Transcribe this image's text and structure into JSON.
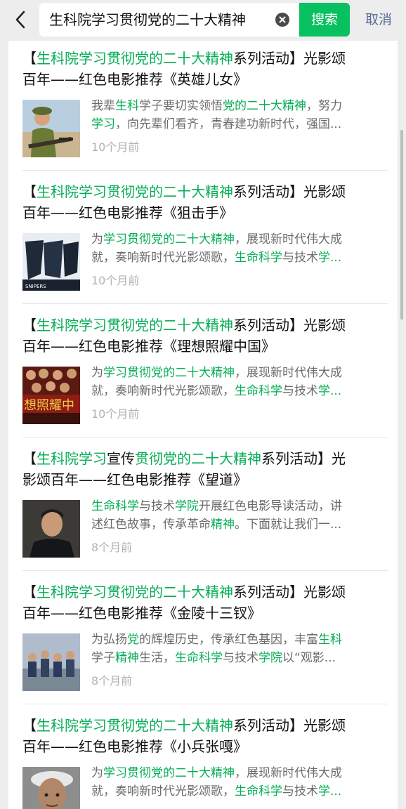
{
  "search": {
    "query": "生科院学习贯彻党的二十大精神",
    "button_label": "搜索",
    "cancel_label": "取消"
  },
  "colors": {
    "highlight": "#06ad56",
    "accent": "#07c160",
    "link": "#576b95"
  },
  "results": [
    {
      "title_segments": [
        {
          "t": "【",
          "h": false
        },
        {
          "t": "生科院学习贯彻党的二十大精神",
          "h": true
        },
        {
          "t": "系列活动】光影颂",
          "h": false
        },
        {
          "t": "百年——红色电影推荐《英雄儿女》",
          "h": false
        }
      ],
      "summary_segments": [
        {
          "t": "我辈",
          "h": false
        },
        {
          "t": "生科",
          "h": true
        },
        {
          "t": "学子要切实领悟",
          "h": false
        },
        {
          "t": "党的二十大精神",
          "h": true
        },
        {
          "t": "，努力",
          "h": false
        },
        {
          "t": "学习",
          "h": true
        },
        {
          "t": "，向先辈们看齐，青春建功新时代，强国...",
          "h": false
        }
      ],
      "time": "10个月前",
      "thumb": "soldier-thumbnail"
    },
    {
      "title_segments": [
        {
          "t": "【",
          "h": false
        },
        {
          "t": "生科院学习贯彻党的二十大精神",
          "h": true
        },
        {
          "t": "系列活动】光影颂",
          "h": false
        },
        {
          "t": "百年——红色电影推荐《狙击手》",
          "h": false
        }
      ],
      "summary_segments": [
        {
          "t": "为",
          "h": false
        },
        {
          "t": "学习贯彻党的二十大精神",
          "h": true
        },
        {
          "t": "，展现新时代伟大成",
          "h": false
        },
        {
          "t": "就，奏响新时代光影颂歌，",
          "h": false
        },
        {
          "t": "生命科学",
          "h": true
        },
        {
          "t": "与技术",
          "h": false
        },
        {
          "t": "学...",
          "h": true
        }
      ],
      "time": "10个月前",
      "thumb": "snipers-poster-thumbnail",
      "thumb_text": "SNIPERS"
    },
    {
      "title_segments": [
        {
          "t": "【",
          "h": false
        },
        {
          "t": "生科院学习贯彻党的二十大精神",
          "h": true
        },
        {
          "t": "系列活动】光影颂",
          "h": false
        },
        {
          "t": "百年——红色电影推荐《理想照耀中国》",
          "h": false
        }
      ],
      "summary_segments": [
        {
          "t": "为",
          "h": false
        },
        {
          "t": "学习贯彻党的二十大精神",
          "h": true
        },
        {
          "t": "，展现新时代伟大成",
          "h": false
        },
        {
          "t": "就，奏响新时代光影颂歌，",
          "h": false
        },
        {
          "t": "生命科学",
          "h": true
        },
        {
          "t": "与技术",
          "h": false
        },
        {
          "t": "学...",
          "h": true
        }
      ],
      "time": "10个月前",
      "thumb": "ideal-poster-thumbnail",
      "thumb_text": "想照耀中"
    },
    {
      "title_segments": [
        {
          "t": "【",
          "h": false
        },
        {
          "t": "生科院学习",
          "h": true
        },
        {
          "t": "宣传",
          "h": false
        },
        {
          "t": "贯彻党的二十大精神",
          "h": true
        },
        {
          "t": "系列活动】光",
          "h": false
        },
        {
          "t": "影颂百年——红色电影推荐《望道》",
          "h": false
        }
      ],
      "summary_segments": [
        {
          "t": "生命科学",
          "h": true
        },
        {
          "t": "与技术",
          "h": false
        },
        {
          "t": "学院",
          "h": true
        },
        {
          "t": "开展红色电影导读活动，讲",
          "h": false
        },
        {
          "t": "述红色故事，传承革命",
          "h": false
        },
        {
          "t": "精神",
          "h": true
        },
        {
          "t": "。下面就让我们一...",
          "h": false
        }
      ],
      "time": "8个月前",
      "thumb": "portrait-thumbnail"
    },
    {
      "title_segments": [
        {
          "t": "【",
          "h": false
        },
        {
          "t": "生科院学习贯彻党的二十大精神",
          "h": true
        },
        {
          "t": "系列活动】光影颂",
          "h": false
        },
        {
          "t": "百年——红色电影推荐《金陵十三钗》",
          "h": false
        }
      ],
      "summary_segments": [
        {
          "t": "为弘扬",
          "h": false
        },
        {
          "t": "党",
          "h": true
        },
        {
          "t": "的辉煌历史，传承红色基因，丰富",
          "h": false
        },
        {
          "t": "生科",
          "h": true
        },
        {
          "t": "学子",
          "h": false
        },
        {
          "t": "精神",
          "h": true
        },
        {
          "t": "生活，",
          "h": false
        },
        {
          "t": "生命科学",
          "h": true
        },
        {
          "t": "与技术",
          "h": false
        },
        {
          "t": "学院",
          "h": true
        },
        {
          "t": "以“观影...",
          "h": false
        }
      ],
      "time": "8个月前",
      "thumb": "group-scene-thumbnail"
    },
    {
      "title_segments": [
        {
          "t": "【",
          "h": false
        },
        {
          "t": "生科院学习贯彻党的二十大精神",
          "h": true
        },
        {
          "t": "系列活动】光影颂",
          "h": false
        },
        {
          "t": "百年——红色电影推荐《小兵张嘎》",
          "h": false
        }
      ],
      "summary_segments": [
        {
          "t": "为",
          "h": false
        },
        {
          "t": "学习贯彻党的二十大精神",
          "h": true
        },
        {
          "t": "，展现新时代伟大成",
          "h": false
        },
        {
          "t": "就，奏响新时代光影颂歌，",
          "h": false
        },
        {
          "t": "生命科学",
          "h": true
        },
        {
          "t": "与技术",
          "h": false
        },
        {
          "t": "学...",
          "h": true
        }
      ],
      "time": "",
      "thumb": "boy-thumbnail"
    }
  ]
}
